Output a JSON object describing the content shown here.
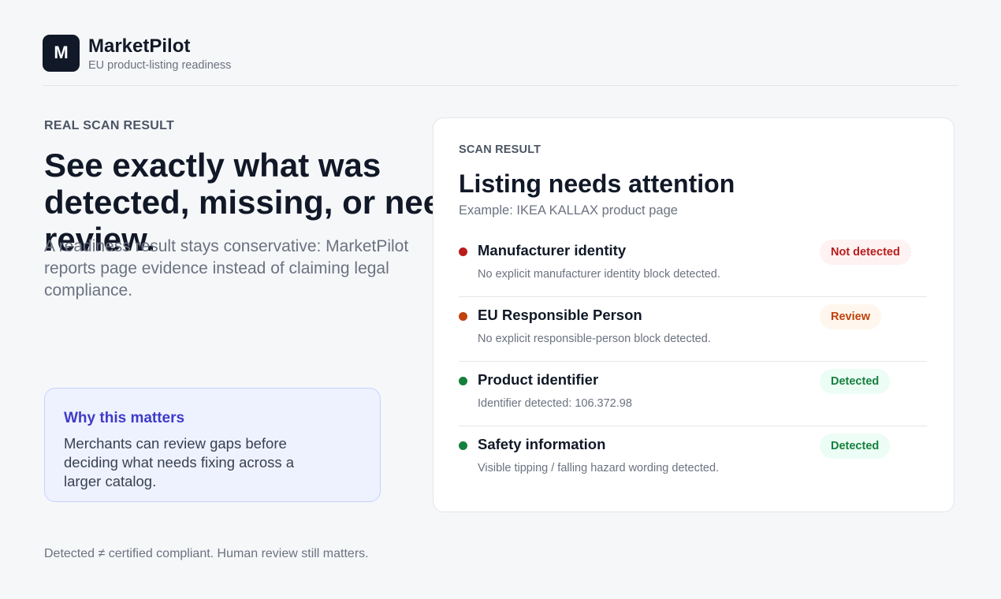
{
  "brand": {
    "logo_letter": "M",
    "name": "MarketPilot",
    "tagline": "EU product-listing readiness"
  },
  "hero": {
    "eyebrow": "REAL SCAN RESULT",
    "headline": "See exactly what was detected, missing, or needs review.",
    "lead": "A readiness result stays conservative: MarketPilot reports page evidence instead of claiming legal compliance."
  },
  "why": {
    "title": "Why this matters",
    "text": "Merchants can review gaps before deciding what needs fixing across a larger catalog."
  },
  "footer_note": "Detected ≠ certified compliant. Human review still matters.",
  "scan": {
    "eyebrow": "SCAN RESULT",
    "title": "Listing needs attention",
    "subtitle": "Example: IKEA KALLAX product page",
    "items": [
      {
        "title": "Manufacturer identity",
        "desc": "No explicit manufacturer identity block detected.",
        "status": "Not detected",
        "status_color": "#b91c1c"
      },
      {
        "title": "EU Responsible Person",
        "desc": "No explicit responsible-person block detected.",
        "status": "Review",
        "status_color": "#c2410c"
      },
      {
        "title": "Product identifier",
        "desc": "Identifier detected: 106.372.98",
        "status": "Detected",
        "status_color": "#15803d"
      },
      {
        "title": "Safety information",
        "desc": "Visible tipping / falling hazard wording detected.",
        "status": "Detected",
        "status_color": "#15803d"
      }
    ]
  }
}
